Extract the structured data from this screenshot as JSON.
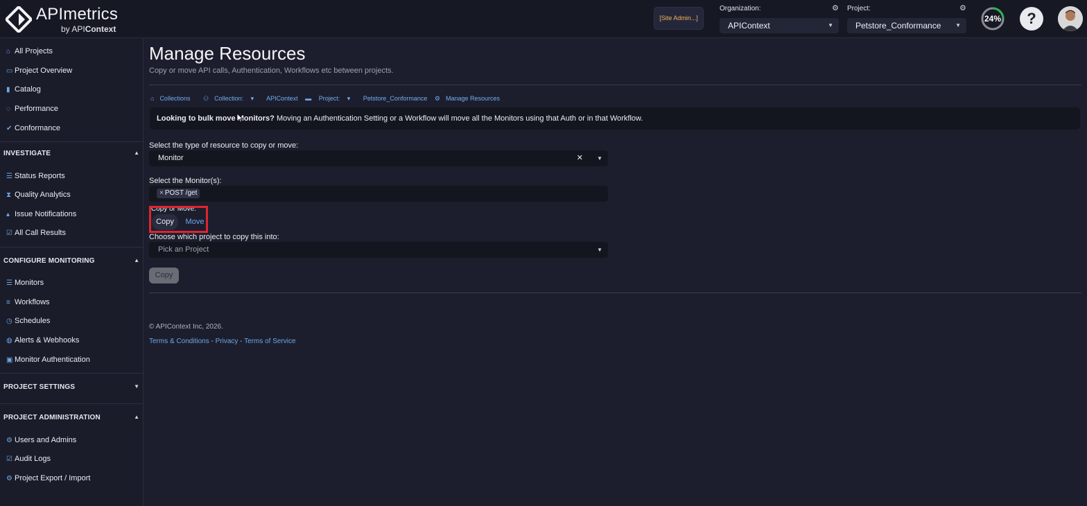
{
  "header": {
    "brand": "APImetrics",
    "brand_sub_prefix": "by API",
    "brand_sub_bold": "Context",
    "site_admin": "[Site Admin...]",
    "org_label": "Organization:",
    "org_value": "APIContext",
    "project_label": "Project:",
    "project_value": "Petstore_Conformance",
    "progress": "24%",
    "help": "?"
  },
  "sidebar": {
    "top_items": [
      {
        "label": "All Projects",
        "icon": "home-icon"
      },
      {
        "label": "Project Overview",
        "icon": "folder-open-icon"
      },
      {
        "label": "Catalog",
        "icon": "book-icon"
      },
      {
        "label": "Performance",
        "icon": "dashboard-icon"
      },
      {
        "label": "Conformance",
        "icon": "check-icon"
      }
    ],
    "investigate": {
      "title": "INVESTIGATE",
      "items": [
        {
          "label": "Status Reports",
          "icon": "list-icon"
        },
        {
          "label": "Quality Analytics",
          "icon": "hourglass-icon"
        },
        {
          "label": "Issue Notifications",
          "icon": "bell-icon"
        },
        {
          "label": "All Call Results",
          "icon": "checkbox-icon"
        }
      ]
    },
    "configure": {
      "title": "CONFIGURE MONITORING",
      "items": [
        {
          "label": "Monitors",
          "icon": "list-icon"
        },
        {
          "label": "Workflows",
          "icon": "stack-icon"
        },
        {
          "label": "Schedules",
          "icon": "clock-icon"
        },
        {
          "label": "Alerts & Webhooks",
          "icon": "globe-icon"
        },
        {
          "label": "Monitor Authentication",
          "icon": "lock-icon"
        }
      ]
    },
    "settings": {
      "title": "PROJECT SETTINGS"
    },
    "admin": {
      "title": "PROJECT ADMINISTRATION",
      "items": [
        {
          "label": "Users and Admins",
          "icon": "gear-icon"
        },
        {
          "label": "Audit Logs",
          "icon": "checkbox-icon"
        },
        {
          "label": "Project Export / Import",
          "icon": "gear-icon"
        }
      ]
    }
  },
  "main": {
    "title": "Manage Resources",
    "subtitle": "Copy or move API calls, Authentication, Workflows etc between projects.",
    "breadcrumbs": {
      "collections": "Collections",
      "collection_label": "Collection:",
      "collection_value": "APIContext",
      "project_label": "Project:",
      "project_value": "Petstore_Conformance",
      "current": "Manage Resources"
    },
    "info": {
      "bold": "Looking to bulk move Monitors?",
      "text": " Moving an Authentication Setting or a Workflow will move all the Monitors using that Auth or in that Workflow."
    },
    "resource_type_label": "Select the type of resource to copy or move:",
    "resource_type_value": "Monitor",
    "monitors_label": "Select the Monitor(s):",
    "monitor_tag": "POST /get",
    "copy_move_label": "Copy or Move:",
    "copy_option": "Copy",
    "move_option": "Move",
    "target_label": "Choose which project to copy this into:",
    "target_placeholder": "Pick an Project",
    "submit_label": "Copy"
  },
  "footer": {
    "copyright": "© APIContext Inc, 2026.",
    "terms": "Terms & Conditions",
    "privacy": "Privacy",
    "tos": "Terms of Service",
    "sep": " - "
  }
}
